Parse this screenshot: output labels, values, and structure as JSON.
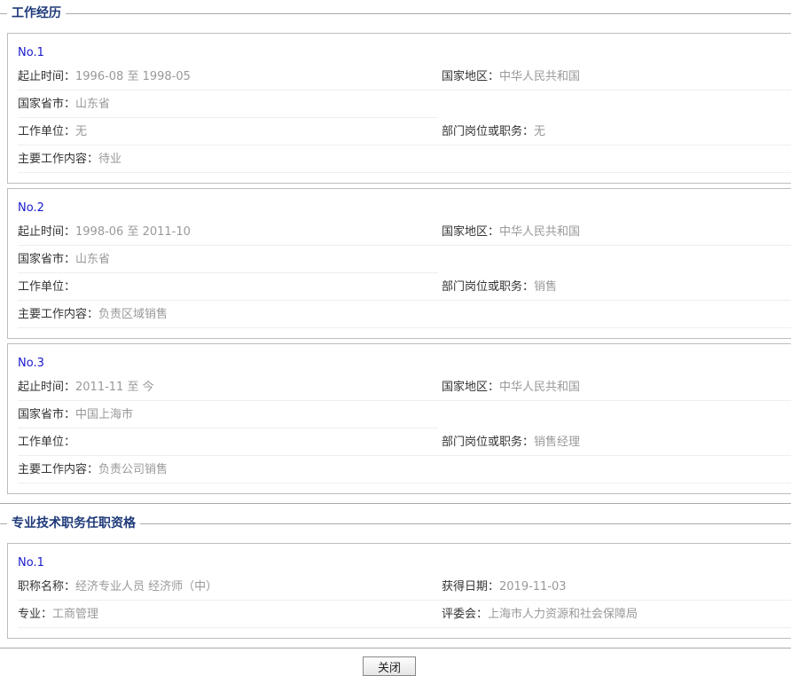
{
  "work_section": {
    "title": "工作经历",
    "entries": [
      {
        "no": "No.1",
        "period_label": "起止时间：",
        "period": "1996-08 至 1998-05",
        "country_label": "国家地区：",
        "country": "中华人民共和国",
        "province_label": "国家省市：",
        "province": "山东省",
        "company_label": "工作单位：",
        "company": "无",
        "position_label": "部门岗位或职务：",
        "position": "无",
        "content_label": "主要工作内容：",
        "content": "待业"
      },
      {
        "no": "No.2",
        "period_label": "起止时间：",
        "period": "1998-06 至 2011-10",
        "country_label": "国家地区：",
        "country": "中华人民共和国",
        "province_label": "国家省市：",
        "province": "山东省",
        "company_label": "工作单位：",
        "company": "",
        "position_label": "部门岗位或职务：",
        "position": "销售",
        "content_label": "主要工作内容：",
        "content": "负责区域销售"
      },
      {
        "no": "No.3",
        "period_label": "起止时间：",
        "period": "2011-11 至 今",
        "country_label": "国家地区：",
        "country": "中华人民共和国",
        "province_label": "国家省市：",
        "province": "中国上海市",
        "company_label": "工作单位：",
        "company": "",
        "position_label": "部门岗位或职务：",
        "position": "销售经理",
        "content_label": "主要工作内容：",
        "content": "负责公司销售"
      }
    ]
  },
  "qual_section": {
    "title": "专业技术职务任职资格",
    "entries": [
      {
        "no": "No.1",
        "title_label": "职称名称：",
        "title_value": "经济专业人员 经济师（中）",
        "date_label": "获得日期：",
        "date": "2019-11-03",
        "major_label": "专业：",
        "major": "工商管理",
        "committee_label": "评委会：",
        "committee": "上海市人力资源和社会保障局"
      }
    ]
  },
  "close_button": "关闭"
}
